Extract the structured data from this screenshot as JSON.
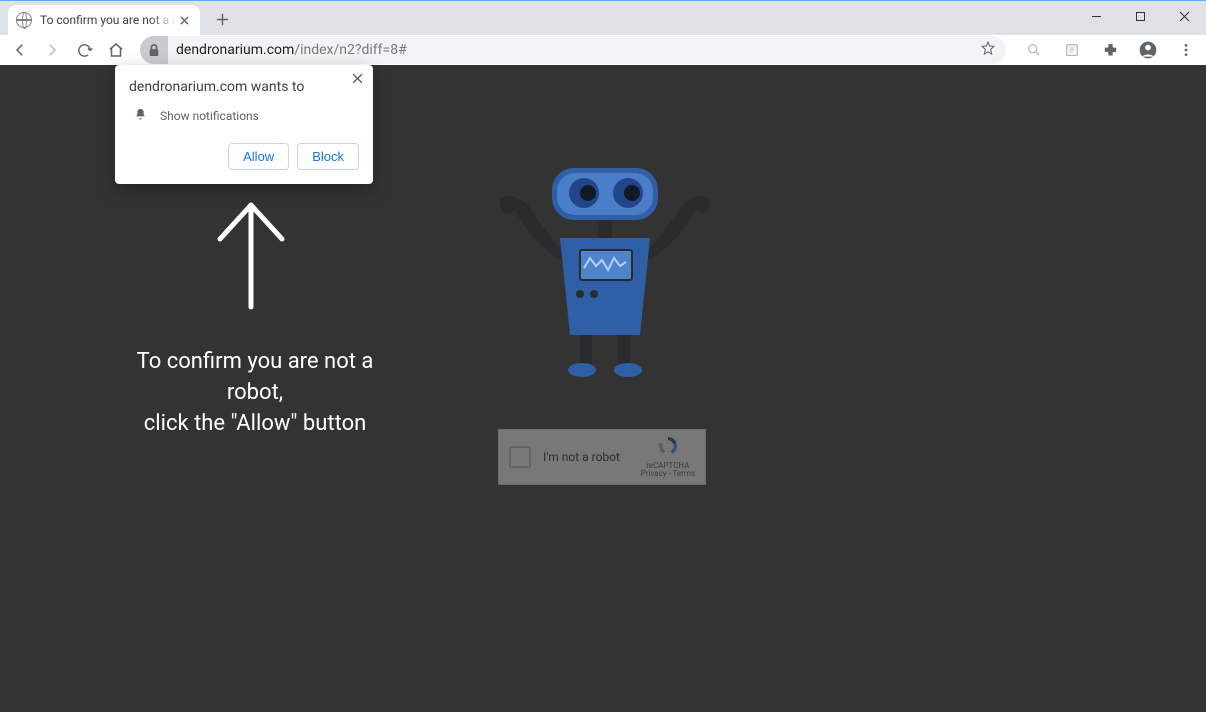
{
  "tab": {
    "title": "To confirm you are not a robot, click the \"Allow\" button"
  },
  "url": {
    "host": "dendronarium.com",
    "path": "/index/n2?diff=8#"
  },
  "permission": {
    "host_line": "dendronarium.com wants to",
    "request": "Show notifications",
    "allow": "Allow",
    "block": "Block"
  },
  "page": {
    "line1": "To confirm you are not a robot,",
    "line2": "click the \"Allow\" button"
  },
  "captcha": {
    "label": "I'm not a robot",
    "brand": "reCAPTCHA",
    "legal": "Privacy - Terms"
  }
}
